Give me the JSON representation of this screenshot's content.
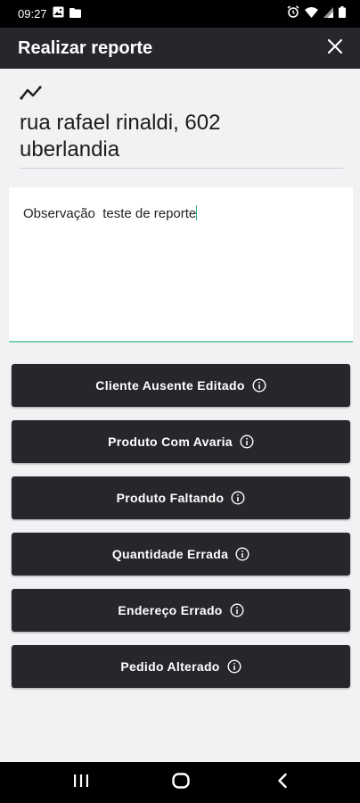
{
  "status_bar": {
    "time": "09:27",
    "icons_left": [
      "image-icon",
      "folder-icon"
    ],
    "icons_right": [
      "alarm-icon",
      "wifi-icon",
      "signal-icon",
      "battery-icon"
    ]
  },
  "app_bar": {
    "title": "Realizar reporte",
    "close_icon": "close-icon"
  },
  "address": {
    "icon": "route-icon",
    "line1": "rua rafael rinaldi, 602",
    "line2": "uberlandia"
  },
  "observation": {
    "value": "Observação  teste de reporte"
  },
  "reasons": [
    {
      "label": "Cliente Ausente Editado",
      "icon": "info-icon"
    },
    {
      "label": "Produto Com Avaria",
      "icon": "info-icon"
    },
    {
      "label": "Produto Faltando",
      "icon": "info-icon"
    },
    {
      "label": "Quantidade Errada",
      "icon": "info-icon"
    },
    {
      "label": "Endereço Errado",
      "icon": "info-icon"
    },
    {
      "label": "Pedido Alterado",
      "icon": "info-icon"
    }
  ],
  "nav_bar": {
    "buttons": [
      "recent-apps-icon",
      "home-icon",
      "back-icon"
    ]
  },
  "colors": {
    "app_bar": "#26272b",
    "background": "#f2f2f5",
    "accent": "#2db37f",
    "button": "#26272b"
  }
}
